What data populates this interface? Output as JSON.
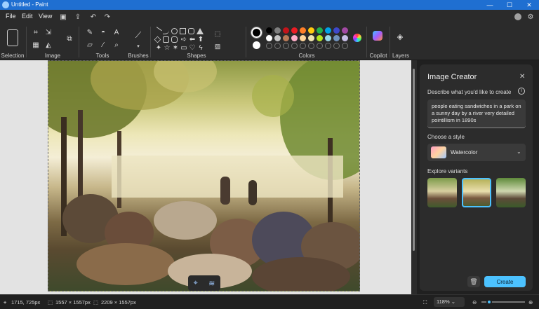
{
  "window": {
    "title": "Untitled - Paint",
    "minimize": "—",
    "maximize": "☐",
    "close": "✕"
  },
  "menu": {
    "file": "File",
    "edit": "Edit",
    "view": "View"
  },
  "ribbon": {
    "selection_label": "Selection",
    "image_label": "Image",
    "tools_label": "Tools",
    "brushes_label": "Brushes",
    "shapes_label": "Shapes",
    "colors_label": "Colors",
    "copilot_label": "Copilot",
    "layers_label": "Layers"
  },
  "colors": {
    "primary": "#000000",
    "secondary": "#ffffff",
    "row1": [
      "#000000",
      "#7f7f7f",
      "#c3141a",
      "#ec1c24",
      "#ff7f27",
      "#ffc90e",
      "#22b14c",
      "#00a2e8",
      "#3f48cc",
      "#a349a4"
    ],
    "row2": [
      "#ffffff",
      "#c3c3c3",
      "#b97a57",
      "#ffaec9",
      "#ffd699",
      "#efe4b0",
      "#b5e61d",
      "#99d9ea",
      "#7092be",
      "#c8bfe7"
    ]
  },
  "panel": {
    "title": "Image Creator",
    "describe_label": "Describe what you'd like to create",
    "prompt_text": "people eating sandwiches in a park on a sunny day by a river very detailed pointillism in 1890s",
    "style_label": "Choose a style",
    "style_value": "Watercolor",
    "variants_label": "Explore variants",
    "create_label": "Create"
  },
  "status": {
    "cursor_pos": "1715, 725px",
    "selection_size": "1557 × 1557px",
    "canvas_size": "2209 × 1557px",
    "zoom": "118%"
  }
}
